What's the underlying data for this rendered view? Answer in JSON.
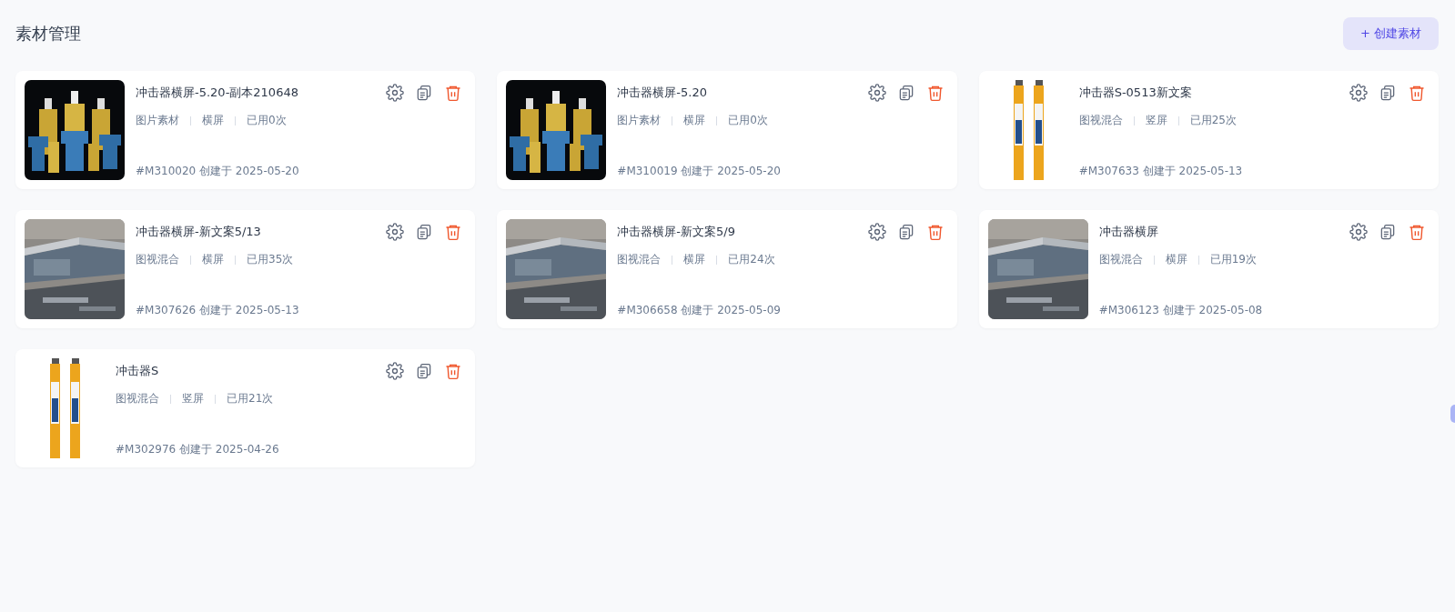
{
  "page_title": "素材管理",
  "create_button": {
    "label": "+ 创建素材"
  },
  "cards": [
    {
      "kind": "landscape",
      "title": "冲击器横屏-5.20-副本210648",
      "meta": [
        "图片素材",
        "横屏",
        "已用0次"
      ],
      "footer": "#M310020 创建于 2025-05-20"
    },
    {
      "kind": "landscape",
      "title": "冲击器横屏-5.20",
      "meta": [
        "图片素材",
        "横屏",
        "已用0次"
      ],
      "footer": "#M310019 创建于 2025-05-20"
    },
    {
      "kind": "portrait",
      "title": "冲击器S-0513新文案",
      "meta": [
        "图视混合",
        "竖屏",
        "已用25次"
      ],
      "footer": "#M307633 创建于 2025-05-13"
    },
    {
      "kind": "landscape",
      "title": "冲击器横屏-新文案5/13",
      "meta": [
        "图视混合",
        "横屏",
        "已用35次"
      ],
      "footer": "#M307626 创建于 2025-05-13"
    },
    {
      "kind": "landscape",
      "title": "冲击器横屏-新文案5/9",
      "meta": [
        "图视混合",
        "横屏",
        "已用24次"
      ],
      "footer": "#M306658 创建于 2025-05-09"
    },
    {
      "kind": "landscape",
      "title": "冲击器横屏",
      "meta": [
        "图视混合",
        "横屏",
        "已用19次"
      ],
      "footer": "#M306123 创建于 2025-05-08"
    },
    {
      "kind": "portrait",
      "title": "冲击器S",
      "meta": [
        "图视混合",
        "竖屏",
        "已用21次"
      ],
      "footer": "#M302976 创建于 2025-04-26"
    }
  ]
}
